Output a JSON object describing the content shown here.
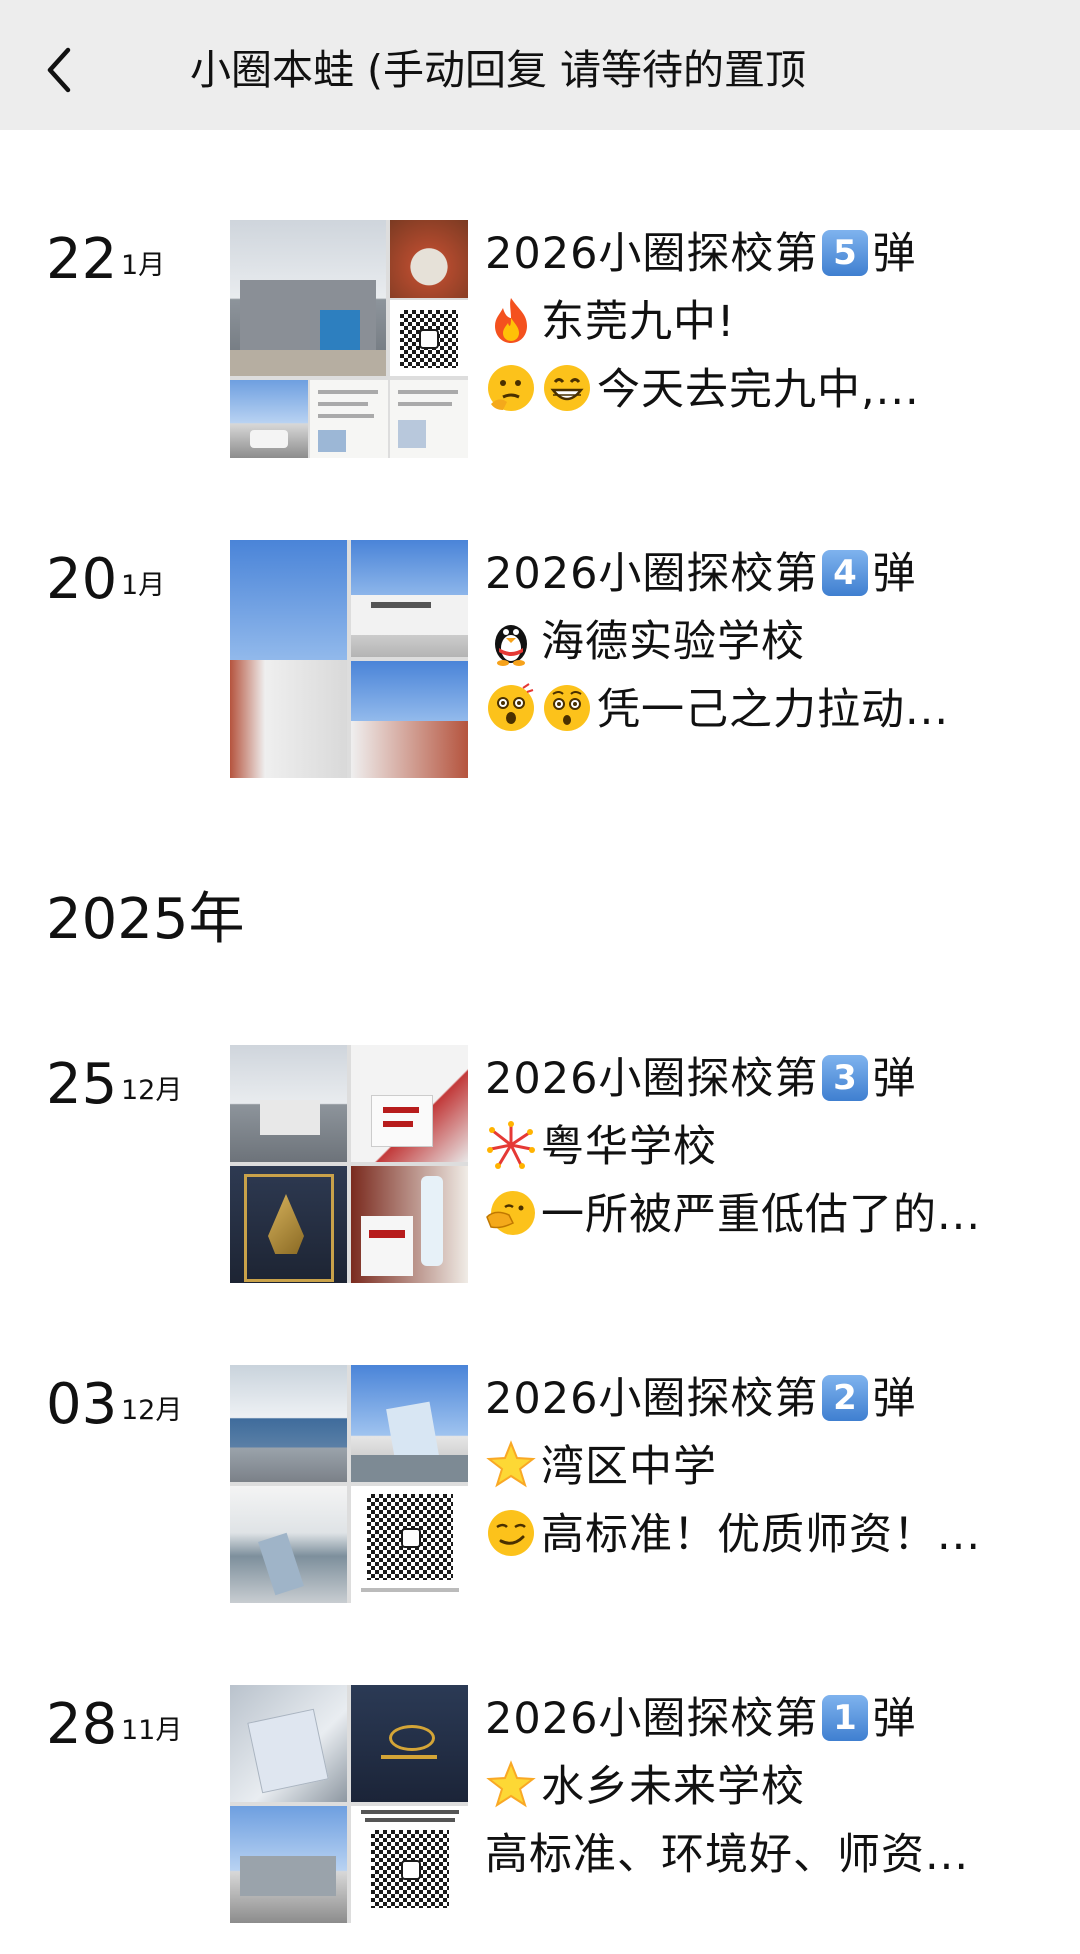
{
  "header": {
    "title": "小圈本蛙 (手动回复 请等待的置顶",
    "back_icon": "chevron-left-icon"
  },
  "colors": {
    "header_bg": "#ededed",
    "page_bg": "#ffffff",
    "text": "#111111",
    "number_badge": "#4f8fdc"
  },
  "year_label": "2025年",
  "posts": [
    {
      "day": "22",
      "month": "1月",
      "title_prefix": "2026小圈探校第",
      "number": "5",
      "title_suffix": "弹",
      "line2_icon": "fire-emoji",
      "line2": "东莞九中!",
      "line3_icons": [
        "thinking-face-emoji",
        "grinning-face-emoji"
      ],
      "line3": "今天去完九中,..."
    },
    {
      "day": "20",
      "month": "1月",
      "title_prefix": "2026小圈探校第",
      "number": "4",
      "title_suffix": "弹",
      "line2_icon": "penguin-emoji",
      "line2": "海德实验学校",
      "line3_icons": [
        "surprised-face-emoji",
        "shocked-face-emoji"
      ],
      "line3": "凭一己之力拉动..."
    },
    {
      "day": "25",
      "month": "12月",
      "title_prefix": "2026小圈探校第",
      "number": "3",
      "title_suffix": "弹",
      "line2_icon": "fireworks-emoji",
      "line2": "粤华学校",
      "line3_icons": [
        "face-with-hand-emoji"
      ],
      "line3": "一所被严重低估了的..."
    },
    {
      "day": "03",
      "month": "12月",
      "title_prefix": "2026小圈探校第",
      "number": "2",
      "title_suffix": "弹",
      "line2_icon": "star-emoji",
      "line2": "湾区中学",
      "line3_icons": [
        "smirking-face-emoji"
      ],
      "line3": "高标准！优质师资！..."
    },
    {
      "day": "28",
      "month": "11月",
      "title_prefix": "2026小圈探校第",
      "number": "1",
      "title_suffix": "弹",
      "line2_icon": "star-emoji",
      "line2": "水乡未来学校",
      "line3_icons": [],
      "line3": "高标准、环境好、师资..."
    }
  ]
}
